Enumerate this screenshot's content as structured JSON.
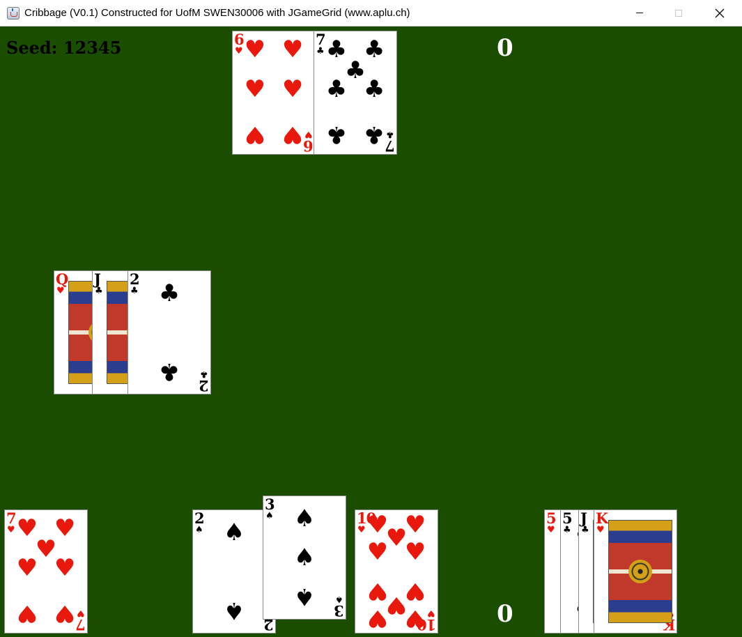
{
  "window": {
    "title": "Cribbage (V0.1) Constructed for UofM SWEN30006 with JGameGrid (www.aplu.ch)",
    "controls": [
      "minimize",
      "maximize",
      "close"
    ]
  },
  "game": {
    "seed_label": "Seed: 12345",
    "score_top": "0",
    "score_bottom": "0"
  },
  "colors": {
    "table": "#1a4d00",
    "red_suit": "#e8180c",
    "black_suit": "#000000"
  },
  "hands": {
    "top_hand": [
      {
        "rank": "6",
        "suit": "♥",
        "color": "red"
      },
      {
        "rank": "7",
        "suit": "♣",
        "color": "black"
      }
    ],
    "play_pile": [
      {
        "rank": "Q",
        "suit": "♥",
        "color": "red"
      },
      {
        "rank": "J",
        "suit": "♣",
        "color": "black"
      },
      {
        "rank": "2",
        "suit": "♣",
        "color": "black"
      }
    ],
    "bottom_single": [
      {
        "rank": "7",
        "suit": "♥",
        "color": "red"
      }
    ],
    "bottom_middle": [
      {
        "rank": "2",
        "suit": "♠",
        "color": "black"
      },
      {
        "rank": "3",
        "suit": "♠",
        "color": "black"
      }
    ],
    "bottom_ten": [
      {
        "rank": "10",
        "suit": "♥",
        "color": "red"
      }
    ],
    "bottom_right": [
      {
        "rank": "5",
        "suit": "♥",
        "color": "red"
      },
      {
        "rank": "5",
        "suit": "♣",
        "color": "black"
      },
      {
        "rank": "J",
        "suit": "♣",
        "color": "black"
      },
      {
        "rank": "K",
        "suit": "♥",
        "color": "red"
      }
    ]
  }
}
